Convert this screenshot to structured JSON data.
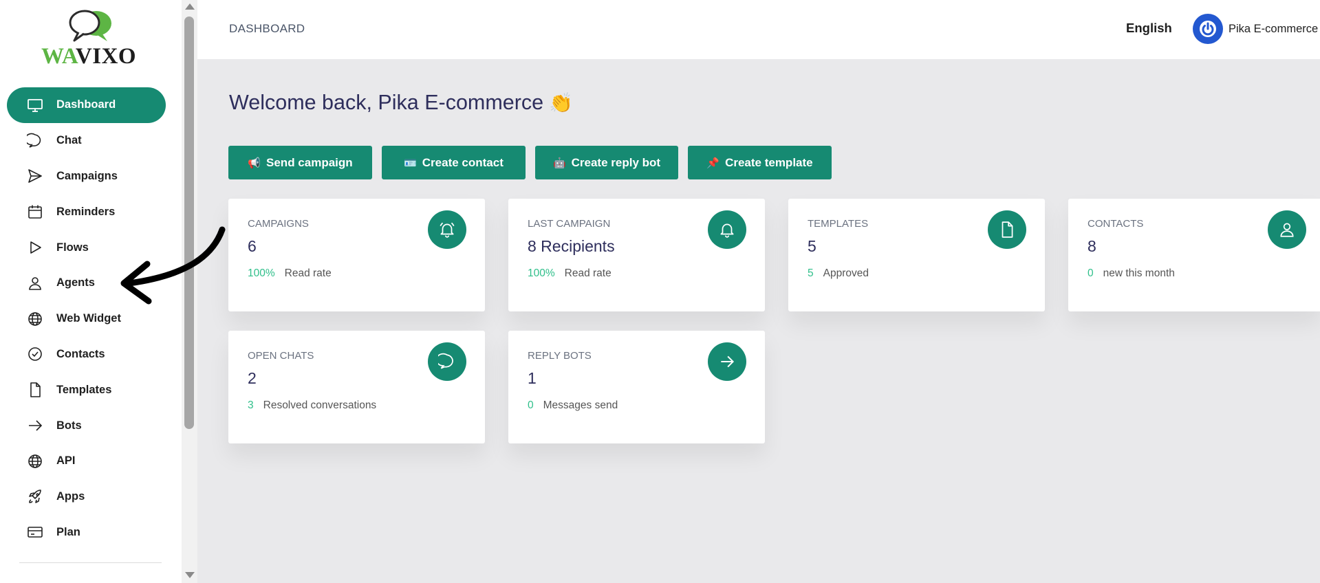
{
  "brand": {
    "logo_wa": "WA",
    "logo_vixo": "VIXO"
  },
  "sidebar": {
    "items": [
      {
        "label": "Dashboard",
        "icon": "monitor-icon",
        "active": true
      },
      {
        "label": "Chat",
        "icon": "chat-icon"
      },
      {
        "label": "Campaigns",
        "icon": "send-icon"
      },
      {
        "label": "Reminders",
        "icon": "calendar-icon"
      },
      {
        "label": "Flows",
        "icon": "play-icon"
      },
      {
        "label": "Agents",
        "icon": "user-icon"
      },
      {
        "label": "Web Widget",
        "icon": "globe-icon"
      },
      {
        "label": "Contacts",
        "icon": "check-circle-icon"
      },
      {
        "label": "Templates",
        "icon": "file-icon"
      },
      {
        "label": "Bots",
        "icon": "arrow-right-icon"
      },
      {
        "label": "API",
        "icon": "globe-icon"
      },
      {
        "label": "Apps",
        "icon": "rocket-icon"
      },
      {
        "label": "Plan",
        "icon": "credit-card-icon"
      }
    ]
  },
  "header": {
    "breadcrumb": "DASHBOARD",
    "language": "English",
    "user_name": "Pika E-commerce"
  },
  "main": {
    "welcome": "Welcome back, Pika E-commerce",
    "welcome_emoji": "👏",
    "actions": [
      {
        "label": "Send campaign",
        "emoji": "📢"
      },
      {
        "label": "Create contact",
        "emoji": "🪪"
      },
      {
        "label": "Create reply bot",
        "emoji": "🤖"
      },
      {
        "label": "Create template",
        "emoji": "📌"
      }
    ],
    "cards": [
      {
        "title": "CAMPAIGNS",
        "value": "6",
        "foot_num": "100%",
        "foot_text": "Read rate",
        "icon": "bell-ring-icon"
      },
      {
        "title": "LAST CAMPAIGN",
        "value": "8 Recipients",
        "foot_num": "100%",
        "foot_text": "Read rate",
        "icon": "bell-icon"
      },
      {
        "title": "TEMPLATES",
        "value": "5",
        "foot_num": "5",
        "foot_text": "Approved",
        "icon": "file-icon"
      },
      {
        "title": "CONTACTS",
        "value": "8",
        "foot_num": "0",
        "foot_text": "new this month",
        "icon": "user-icon"
      },
      {
        "title": "OPEN CHATS",
        "value": "2",
        "foot_num": "3",
        "foot_text": "Resolved conversations",
        "icon": "chat-icon"
      },
      {
        "title": "REPLY BOTS",
        "value": "1",
        "foot_num": "0",
        "foot_text": "Messages send",
        "icon": "arrow-right-icon"
      }
    ]
  },
  "colors": {
    "accent": "#168a72",
    "accent_text_green": "#2fbf8a",
    "heading": "#2e2e5c",
    "avatar_blue": "#2358d0",
    "page_bg": "#e9e9eb"
  }
}
